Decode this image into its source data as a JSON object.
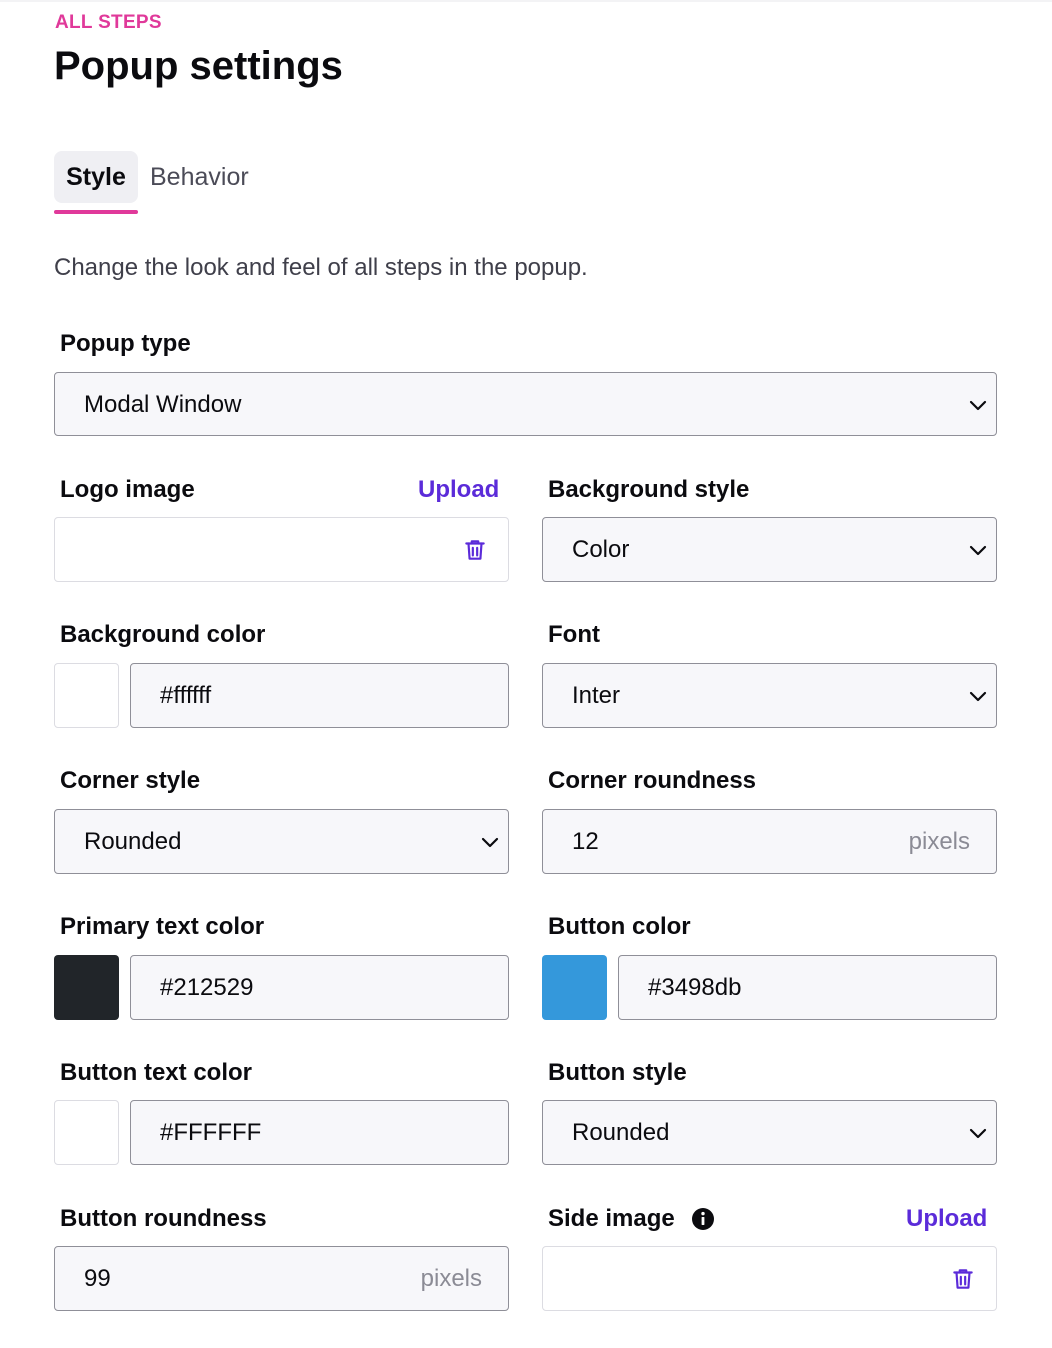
{
  "header": {
    "eyebrow": "ALL STEPS",
    "title": "Popup settings"
  },
  "tabs": [
    {
      "label": "Style",
      "active": true
    },
    {
      "label": "Behavior",
      "active": false
    }
  ],
  "description": "Change the look and feel of all steps in the popup.",
  "fields": {
    "popup_type": {
      "label": "Popup type",
      "value": "Modal Window"
    },
    "logo_image": {
      "label": "Logo image",
      "upload_label": "Upload",
      "value": ""
    },
    "background_style": {
      "label": "Background style",
      "value": "Color"
    },
    "background_color": {
      "label": "Background color",
      "value": "#ffffff"
    },
    "font": {
      "label": "Font",
      "value": "Inter"
    },
    "corner_style": {
      "label": "Corner style",
      "value": "Rounded"
    },
    "corner_roundness": {
      "label": "Corner roundness",
      "value": "12",
      "unit": "pixels"
    },
    "primary_text_color": {
      "label": "Primary text color",
      "value": "#212529"
    },
    "button_color": {
      "label": "Button color",
      "value": "#3498db"
    },
    "button_text_color": {
      "label": "Button text color",
      "value": "#FFFFFF"
    },
    "button_style": {
      "label": "Button style",
      "value": "Rounded"
    },
    "button_roundness": {
      "label": "Button roundness",
      "value": "99",
      "unit": "pixels"
    },
    "side_image": {
      "label": "Side image",
      "upload_label": "Upload",
      "value": ""
    }
  },
  "icons": {
    "select_arrow": "chevron-down-icon",
    "delete": "trash-icon",
    "info": "info-icon"
  },
  "colors": {
    "accent_pink": "#e0399a",
    "accent_purple": "#5b2bd9",
    "text": "#0b0b0f"
  }
}
